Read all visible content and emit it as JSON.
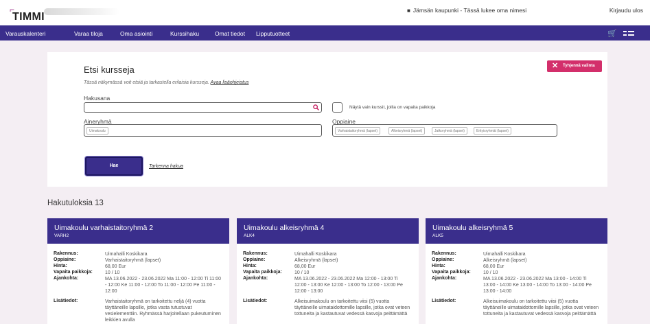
{
  "header": {
    "logo_text": "TIMMI",
    "user_org": "Jämsän kaupunki",
    "user_separator": "-",
    "user_name": "Tässä lukee oma nimesi",
    "login_label": "Kirjaudu ulos"
  },
  "nav": {
    "items": [
      {
        "label": "Varauskalenteri"
      },
      {
        "label": "Varaa tiloja"
      },
      {
        "label": "Oma asiointi"
      },
      {
        "label": "Kurssihaku"
      },
      {
        "label": "Omat tiedot"
      },
      {
        "label": "Lipputuotteet"
      }
    ],
    "cart_icon": "cart-icon",
    "menu_icon": "grid-menu-icon"
  },
  "search": {
    "title": "Etsi kursseja",
    "subtitle": "Tässä näkymässä voit etsiä ja tarkastella erilaisia kursseja.",
    "help_link": "Avaa lisäohjeistus",
    "clear_label": "Tyhjennä valinta",
    "keyword_label": "Hakusana",
    "keyword_value": "",
    "free_only_label": "Näytä vain kurssit, joilla on vapaita paikkoja",
    "group_label": "Aineryhmä",
    "group_chip": "Uimakoulu",
    "subject_label": "Oppiaine",
    "subject_chips": [
      "Varhaistaitoryhmä (lapset)",
      "Alkeisryhmä (lapset)",
      "Jatkoryhmä (lapset)",
      "Erityisryhmät (lapset)"
    ],
    "search_button": "Hae",
    "refine_link": "Tarkenna hakua"
  },
  "results": {
    "count_label": "Hakutuloksia 13",
    "labels": {
      "building": "Rakennus:",
      "subject": "Oppiaine:",
      "price": "Hinta:",
      "free": "Vapaita paikkoja:",
      "time": "Ajankohta:",
      "info": "Lisätiedot:"
    },
    "cards": [
      {
        "title": "Uimakoulu varhaistaitoryhmä 2",
        "code": "VARH2",
        "building": "Uimahalli Koskikara",
        "subject": "Varhaistaitoryhmä (lapset)",
        "price": "68,00 Eur",
        "free": "10 / 10",
        "time": "MA 13.06.2022 - 23.06.2022 Ma 11:00 - 12:00 Ti 11:00 - 12:00 Ke 11:00 - 12:00 To 11:00 - 12:00 Pe 11:00 - 12:00",
        "info": "Varhaistaitoryhmä on tarkoitettu neljä (4) vuotta täyttäneille lapsille, jotka vasta tutustuvat vesielementtiin. Ryhmässä harjoitellaan pukeutuminen leikkien avulla"
      },
      {
        "title": "Uimakoulu alkeisryhmä 4",
        "code": "ALK4",
        "building": "Uimahalli Koskikara",
        "subject": "Alkeisryhmä (lapset)",
        "price": "68,00 Eur",
        "free": "10 / 10",
        "time": "MA 13.06.2022 - 23.06.2022 Ma 12:00 - 13:00 Ti 12:00 - 13:00 Ke 12:00 - 13:00 To 12:00 - 13:00 Pe 12:00 - 13:00",
        "info": "Alkeisuimakoulu on tarkoitettu viisi (5) vuotta täyttäneille uimataidottomille lapsille, jotka ovat veteen tottuneita ja kastautuvat vedessä kasvoja peittämättä"
      },
      {
        "title": "Uimakoulu alkeisryhmä 5",
        "code": "ALK5",
        "building": "Uimahalli Koskikara",
        "subject": "Alkeisryhmä (lapset)",
        "price": "68,00 Eur",
        "free": "10 / 10",
        "time": "MA 13.06.2022 - 23.06.2022 Ma 13:00 - 14:00 Ti 13:00 - 14:00 Ke 13:00 - 14:00 To 13:00 - 14:00 Pe 13:00 - 14:00",
        "info": "Alkeisuimakoulu on tarkoitettu viisi (5) vuotta täyttäneille uimataidottomille lapsille, jotka ovat veteen tottuneita ja kastautuvat vedessä kasvoja peittämättä"
      }
    ]
  },
  "colors": {
    "primary": "#3a2e8c",
    "clear_button": "#d32f6b",
    "background": "#f4eef3"
  }
}
